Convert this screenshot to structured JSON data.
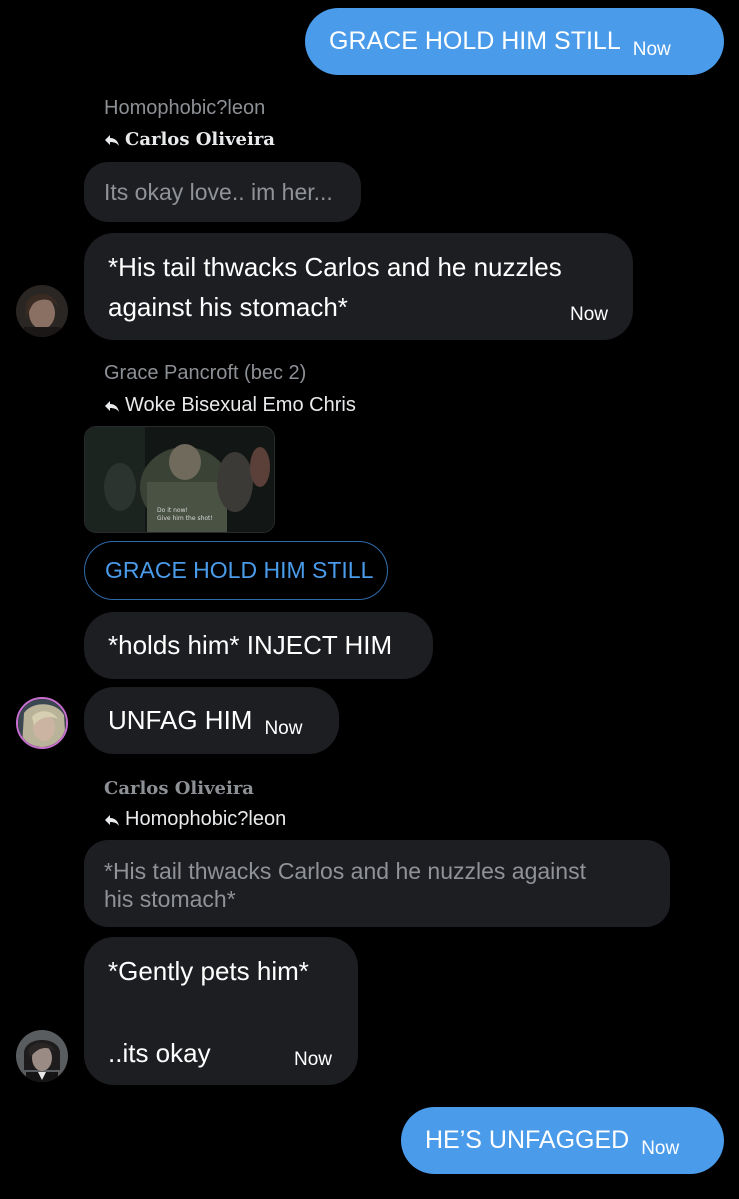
{
  "messages": {
    "m1": {
      "text": "GRACE HOLD HIM STILL",
      "time": "Now"
    },
    "m2": {
      "sender": "Homophobic?leon",
      "reply_to": "Carlos Oliveira",
      "quote": "Its okay love.. im her...",
      "line1": "*His tail thwacks Carlos and he nuzzles",
      "line2": "against his stomach*",
      "time": "Now",
      "avatar_icon": "avatar-leon"
    },
    "m3": {
      "sender": "Grace Pancroft (bec 2)",
      "reply_to": "Woke Bisexual Emo Chris",
      "quote": "GRACE HOLD HIM STILL",
      "image_caption_1": "Do it now!",
      "image_caption_2": "Give him the shot!",
      "text": "*holds him* INJECT HIM",
      "text2": "UNFAG HIM",
      "time": "Now",
      "avatar_icon": "avatar-grace"
    },
    "m4": {
      "sender": "Carlos Oliveira",
      "reply_to": "Homophobic?leon",
      "quote_line1": "*His tail thwacks Carlos and he nuzzles against",
      "quote_line2": "his stomach*",
      "line1": "*Gently pets him*",
      "line2": "..its okay",
      "time": "Now",
      "avatar_icon": "avatar-carlos"
    },
    "m5": {
      "text": "HE’S UNFAGGED",
      "time": "Now"
    }
  },
  "colors": {
    "background": "#000000",
    "outgoing_bubble": "#4a9be9",
    "incoming_bubble": "#1d1e22",
    "muted_text": "#8d9095",
    "quote_outline": "#4a9be9"
  },
  "icons": {
    "reply": "reply-arrow-icon"
  }
}
